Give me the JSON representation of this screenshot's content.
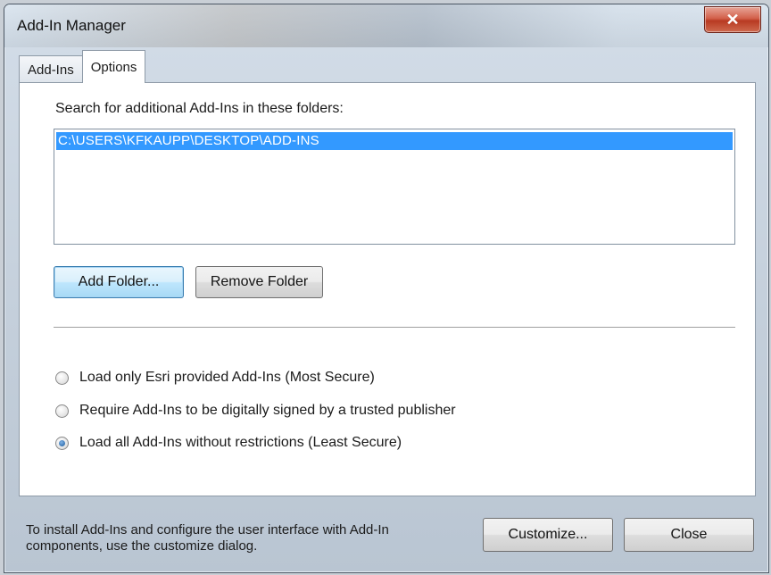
{
  "window": {
    "title": "Add-In Manager",
    "close_glyph": "✕"
  },
  "tabs": [
    {
      "label": "Add-Ins",
      "active": false
    },
    {
      "label": "Options",
      "active": true
    }
  ],
  "options": {
    "search_label": "Search for additional Add-Ins in these folders:",
    "folders": [
      "C:\\USERS\\KFKAUPP\\DESKTOP\\ADD-INS"
    ],
    "selected_folder_index": 0,
    "add_folder_label": "Add Folder...",
    "remove_folder_label": "Remove Folder",
    "security": [
      {
        "label": "Load only Esri provided Add-Ins (Most Secure)",
        "checked": false
      },
      {
        "label": "Require Add-Ins to be digitally signed by a trusted publisher",
        "checked": false
      },
      {
        "label": "Load all Add-Ins without restrictions (Least Secure)",
        "checked": true
      }
    ]
  },
  "footer": {
    "info_line1": "To install Add-Ins and configure the user interface with Add-In",
    "info_line2": "components, use the customize dialog.",
    "customize_label": "Customize...",
    "close_label": "Close"
  },
  "colors": {
    "selection": "#3399ff",
    "close_button": "#c8462e"
  }
}
